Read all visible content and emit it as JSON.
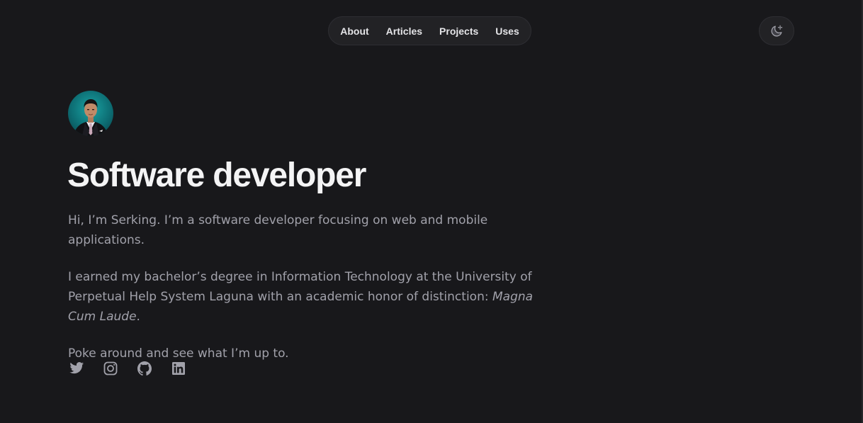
{
  "nav": {
    "items": [
      {
        "label": "About"
      },
      {
        "label": "Articles"
      },
      {
        "label": "Projects"
      },
      {
        "label": "Uses"
      }
    ]
  },
  "theme_toggle": {
    "icon": "moon-sparkle-icon"
  },
  "hero": {
    "title": "Software developer",
    "paragraph1": "Hi, I’m Serking. I’m a software developer focusing on web and mobile applications.",
    "paragraph2_prefix": "I earned my bachelor’s degree in Information Technology at the University of Perpetual Help System Laguna with an academic honor of distinction: ",
    "paragraph2_emphasis": "Magna Cum Laude",
    "paragraph2_suffix": ".",
    "paragraph3": "Poke around and see what I’m up to."
  },
  "socials": [
    {
      "icon": "twitter-icon"
    },
    {
      "icon": "instagram-icon"
    },
    {
      "icon": "github-icon"
    },
    {
      "icon": "linkedin-icon"
    }
  ],
  "colors": {
    "background": "#18181b",
    "text_primary": "#f4f4f5",
    "text_secondary": "#a1a1aa",
    "icon": "#a1a1aa"
  }
}
